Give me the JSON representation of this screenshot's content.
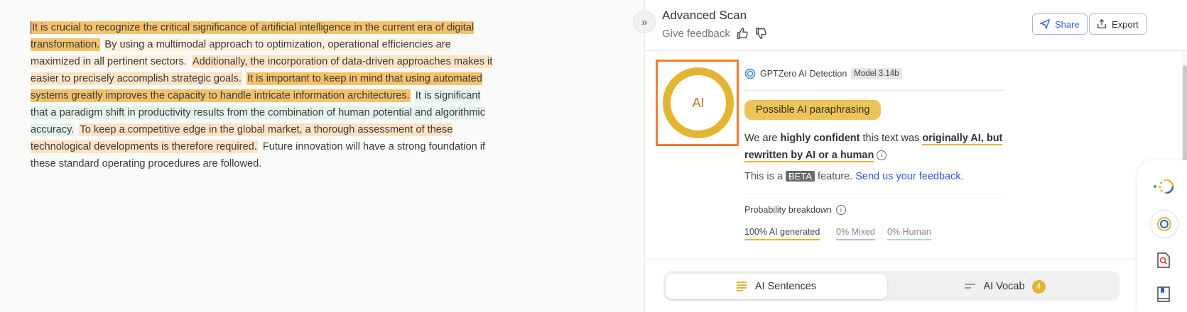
{
  "editor": {
    "segments": [
      {
        "text": "It is crucial to recognize the critical significance of artificial intelligence in the current era of digital transformation.",
        "style": "strong"
      },
      {
        "text": " ",
        "style": "none"
      },
      {
        "text": "By using a multimodal approach to optimization, operational efficiencies are maximized in all pertinent sectors.",
        "style": "light"
      },
      {
        "text": " ",
        "style": "none"
      },
      {
        "text": "Additionally, the incorporation of data-driven approaches makes it easier to precisely accomplish strategic goals.",
        "style": "mid"
      },
      {
        "text": " ",
        "style": "none"
      },
      {
        "text": "It is important to keep in mind that using automated systems greatly improves the capacity to handle intricate information architectures.",
        "style": "strong"
      },
      {
        "text": " ",
        "style": "none"
      },
      {
        "text": "It is significant that a paradigm shift in productivity results from the combination of human potential and algorithmic accuracy.",
        "style": "green"
      },
      {
        "text": " ",
        "style": "none"
      },
      {
        "text": "To keep a competitive edge in the global market, a thorough assessment of these technological developments is therefore required.",
        "style": "mid"
      },
      {
        "text": " ",
        "style": "none"
      },
      {
        "text": "Future innovation will have a strong foundation if these standard operating procedures are followed.",
        "style": "none"
      }
    ]
  },
  "panel": {
    "title": "Advanced Scan",
    "give_feedback": "Give feedback",
    "share_label": "Share",
    "export_label": "Export",
    "ring_label": "AI",
    "detector_name": "GPTZero AI Detection",
    "model_tag": "Model 3.14b",
    "verdict_pill": "Possible AI paraphrasing",
    "verdict": {
      "pre": "We are ",
      "confidence": "highly confident",
      "mid": " this text was ",
      "result": "originally AI, but rewritten by AI or a human"
    },
    "beta": {
      "pre": "This is a ",
      "tag": "BETA",
      "mid": " feature. ",
      "link": "Send us your feedback."
    },
    "probability_title": "Probability breakdown",
    "prob_ai": "100% AI generated",
    "prob_mixed": "0% Mixed",
    "prob_human": "0% Human",
    "tab_sentences": "AI Sentences",
    "tab_vocab": "AI Vocab",
    "vocab_count": "4"
  },
  "colors": {
    "accent": "#e3b532",
    "highlight_box": "#f57c2e",
    "link": "#2a5bd7"
  }
}
